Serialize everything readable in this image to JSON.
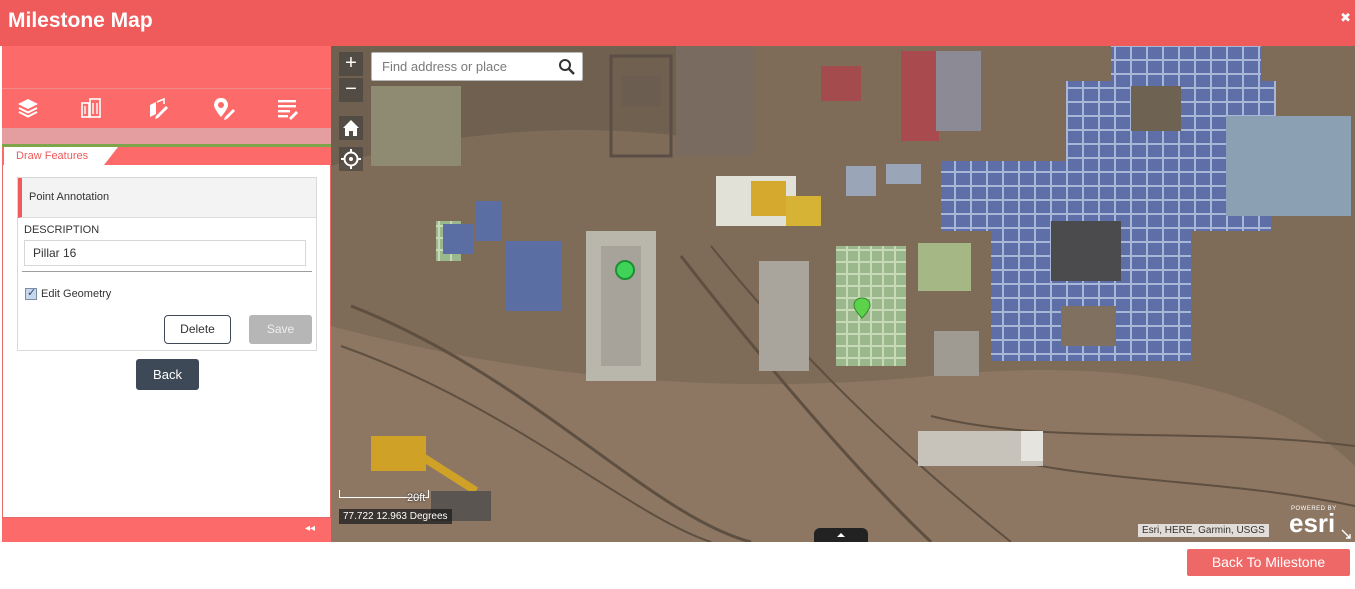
{
  "window": {
    "title": "Milestone Map",
    "close_icon": "close-icon"
  },
  "toolbar": {
    "tools": [
      {
        "icon": "layers-icon"
      },
      {
        "icon": "buildings-icon"
      },
      {
        "icon": "edit-map-icon"
      },
      {
        "icon": "pin-edit-icon"
      },
      {
        "icon": "list-edit-icon"
      }
    ]
  },
  "panel": {
    "tab_label": "Draw Features",
    "card_title": "Point Annotation",
    "description_label": "DESCRIPTION",
    "description_value": "Pillar 16",
    "edit_geometry_label": "Edit Geometry",
    "edit_geometry_checked": true,
    "delete_label": "Delete",
    "save_label": "Save",
    "back_label": "Back",
    "collapse_icon": "double-chevron-left-icon"
  },
  "map": {
    "zoom_in": "+",
    "zoom_out": "−",
    "search_placeholder": "Find address or place",
    "scale_label": "20ft",
    "coordinates": "77.722 12.963 Degrees",
    "attribution": "Esri, HERE, Garmin, USGS",
    "powered_by": "POWERED BY",
    "esri_logo": "esri"
  },
  "footer": {
    "back_to_milestone_label": "Back To Milestone"
  },
  "colors": {
    "header": "#ef5a5a",
    "panel": "#fd6a6a",
    "back_button": "#3e4957",
    "marker": "#3fd35a"
  }
}
